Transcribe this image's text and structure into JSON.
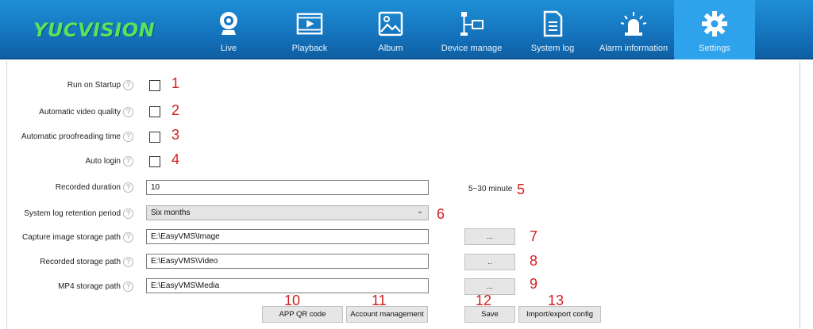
{
  "brand": "YUCVISION",
  "nav": [
    {
      "id": "live",
      "label": "Live",
      "icon": "webcam-icon",
      "active": false
    },
    {
      "id": "playback",
      "label": "Playback",
      "icon": "film-play-icon",
      "active": false
    },
    {
      "id": "album",
      "label": "Album",
      "icon": "image-icon",
      "active": false
    },
    {
      "id": "device",
      "label": "Device manage",
      "icon": "network-device-icon",
      "active": false
    },
    {
      "id": "syslog",
      "label": "System log",
      "icon": "document-icon",
      "active": false
    },
    {
      "id": "alarm",
      "label": "Alarm information",
      "icon": "siren-icon",
      "active": false
    },
    {
      "id": "settings",
      "label": "Settings",
      "icon": "gear-icon",
      "active": true
    }
  ],
  "settings": {
    "run_on_startup": {
      "label": "Run on Startup",
      "checked": false,
      "marker": "1"
    },
    "auto_video_quality": {
      "label": "Automatic video quality",
      "checked": false,
      "marker": "2"
    },
    "auto_proofreading_time": {
      "label": "Automatic proofreading time",
      "checked": false,
      "marker": "3"
    },
    "auto_login": {
      "label": "Auto login",
      "checked": false,
      "marker": "4"
    },
    "recorded_duration": {
      "label": "Recorded duration",
      "value": "10",
      "hint": "5~30 minute",
      "marker": "5"
    },
    "log_retention": {
      "label": "System log retention period",
      "value": "Six months",
      "marker": "6"
    },
    "capture_path": {
      "label": "Capture image storage path",
      "value": "E:\\EasyVMS\\Image",
      "browse": "...",
      "marker": "7"
    },
    "recorded_path": {
      "label": "Recorded storage path",
      "value": "E:\\EasyVMS\\Video",
      "browse": "..",
      "marker": "8"
    },
    "mp4_path": {
      "label": "MP4 storage path",
      "value": "E:\\EasyVMS\\Media",
      "browse": "...",
      "marker": "9"
    }
  },
  "actions": {
    "app_qr": {
      "label": "APP QR code",
      "marker": "10"
    },
    "account": {
      "label": "Account management",
      "marker": "11"
    },
    "save": {
      "label": "Save",
      "marker": "12"
    },
    "import_export": {
      "label": "Import/export config",
      "marker": "13"
    }
  },
  "help_glyph": "?",
  "select_arrow": "⌄",
  "colors": {
    "nav_bar": "#1576bf",
    "nav_active": "#2ea2ea",
    "brand": "#58e35b",
    "marker": "#d42020"
  }
}
